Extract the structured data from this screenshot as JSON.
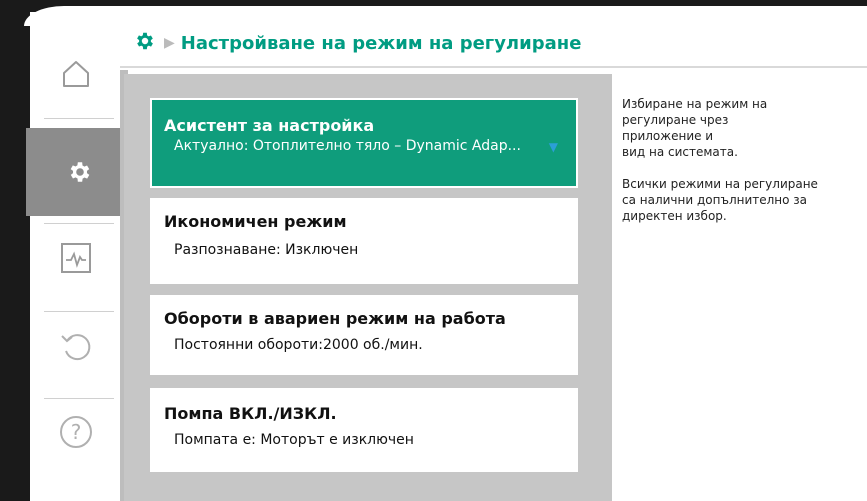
{
  "header": {
    "title": "Настройване на режим на регулиране",
    "icon": "gear-icon",
    "accent": "#009c82"
  },
  "nav": {
    "items": [
      {
        "icon": "home-icon",
        "active": false
      },
      {
        "icon": "gear-icon",
        "active": true
      },
      {
        "icon": "diagnostics-icon",
        "active": false
      },
      {
        "icon": "undo-icon",
        "active": false
      },
      {
        "icon": "help-icon",
        "active": false
      }
    ]
  },
  "menu": {
    "items": [
      {
        "title": "Асистент за настройка",
        "subtitle": "Актуално: Отоплително тяло – Dynamic Adap...",
        "selected": true
      },
      {
        "title": "Икономичен режим",
        "subtitle": "Разпознаване: Изключен",
        "selected": false
      },
      {
        "title": "Обороти в авариен режим на работа",
        "subtitle": "Постоянни обороти:2000 об./мин.",
        "selected": false
      },
      {
        "title": "Помпа ВКЛ./ИЗКЛ.",
        "subtitle": "Помпата е: Моторът е изключен",
        "selected": false
      }
    ],
    "selected_color": "#0f9d7c"
  },
  "info": {
    "paragraph1": "Избиране на режим на\nрегулиране чрез\nприложение и\nвид на системата.",
    "paragraph2": "Всички режими на регулиране\nса налични допълнително за\nдиректен избор."
  }
}
